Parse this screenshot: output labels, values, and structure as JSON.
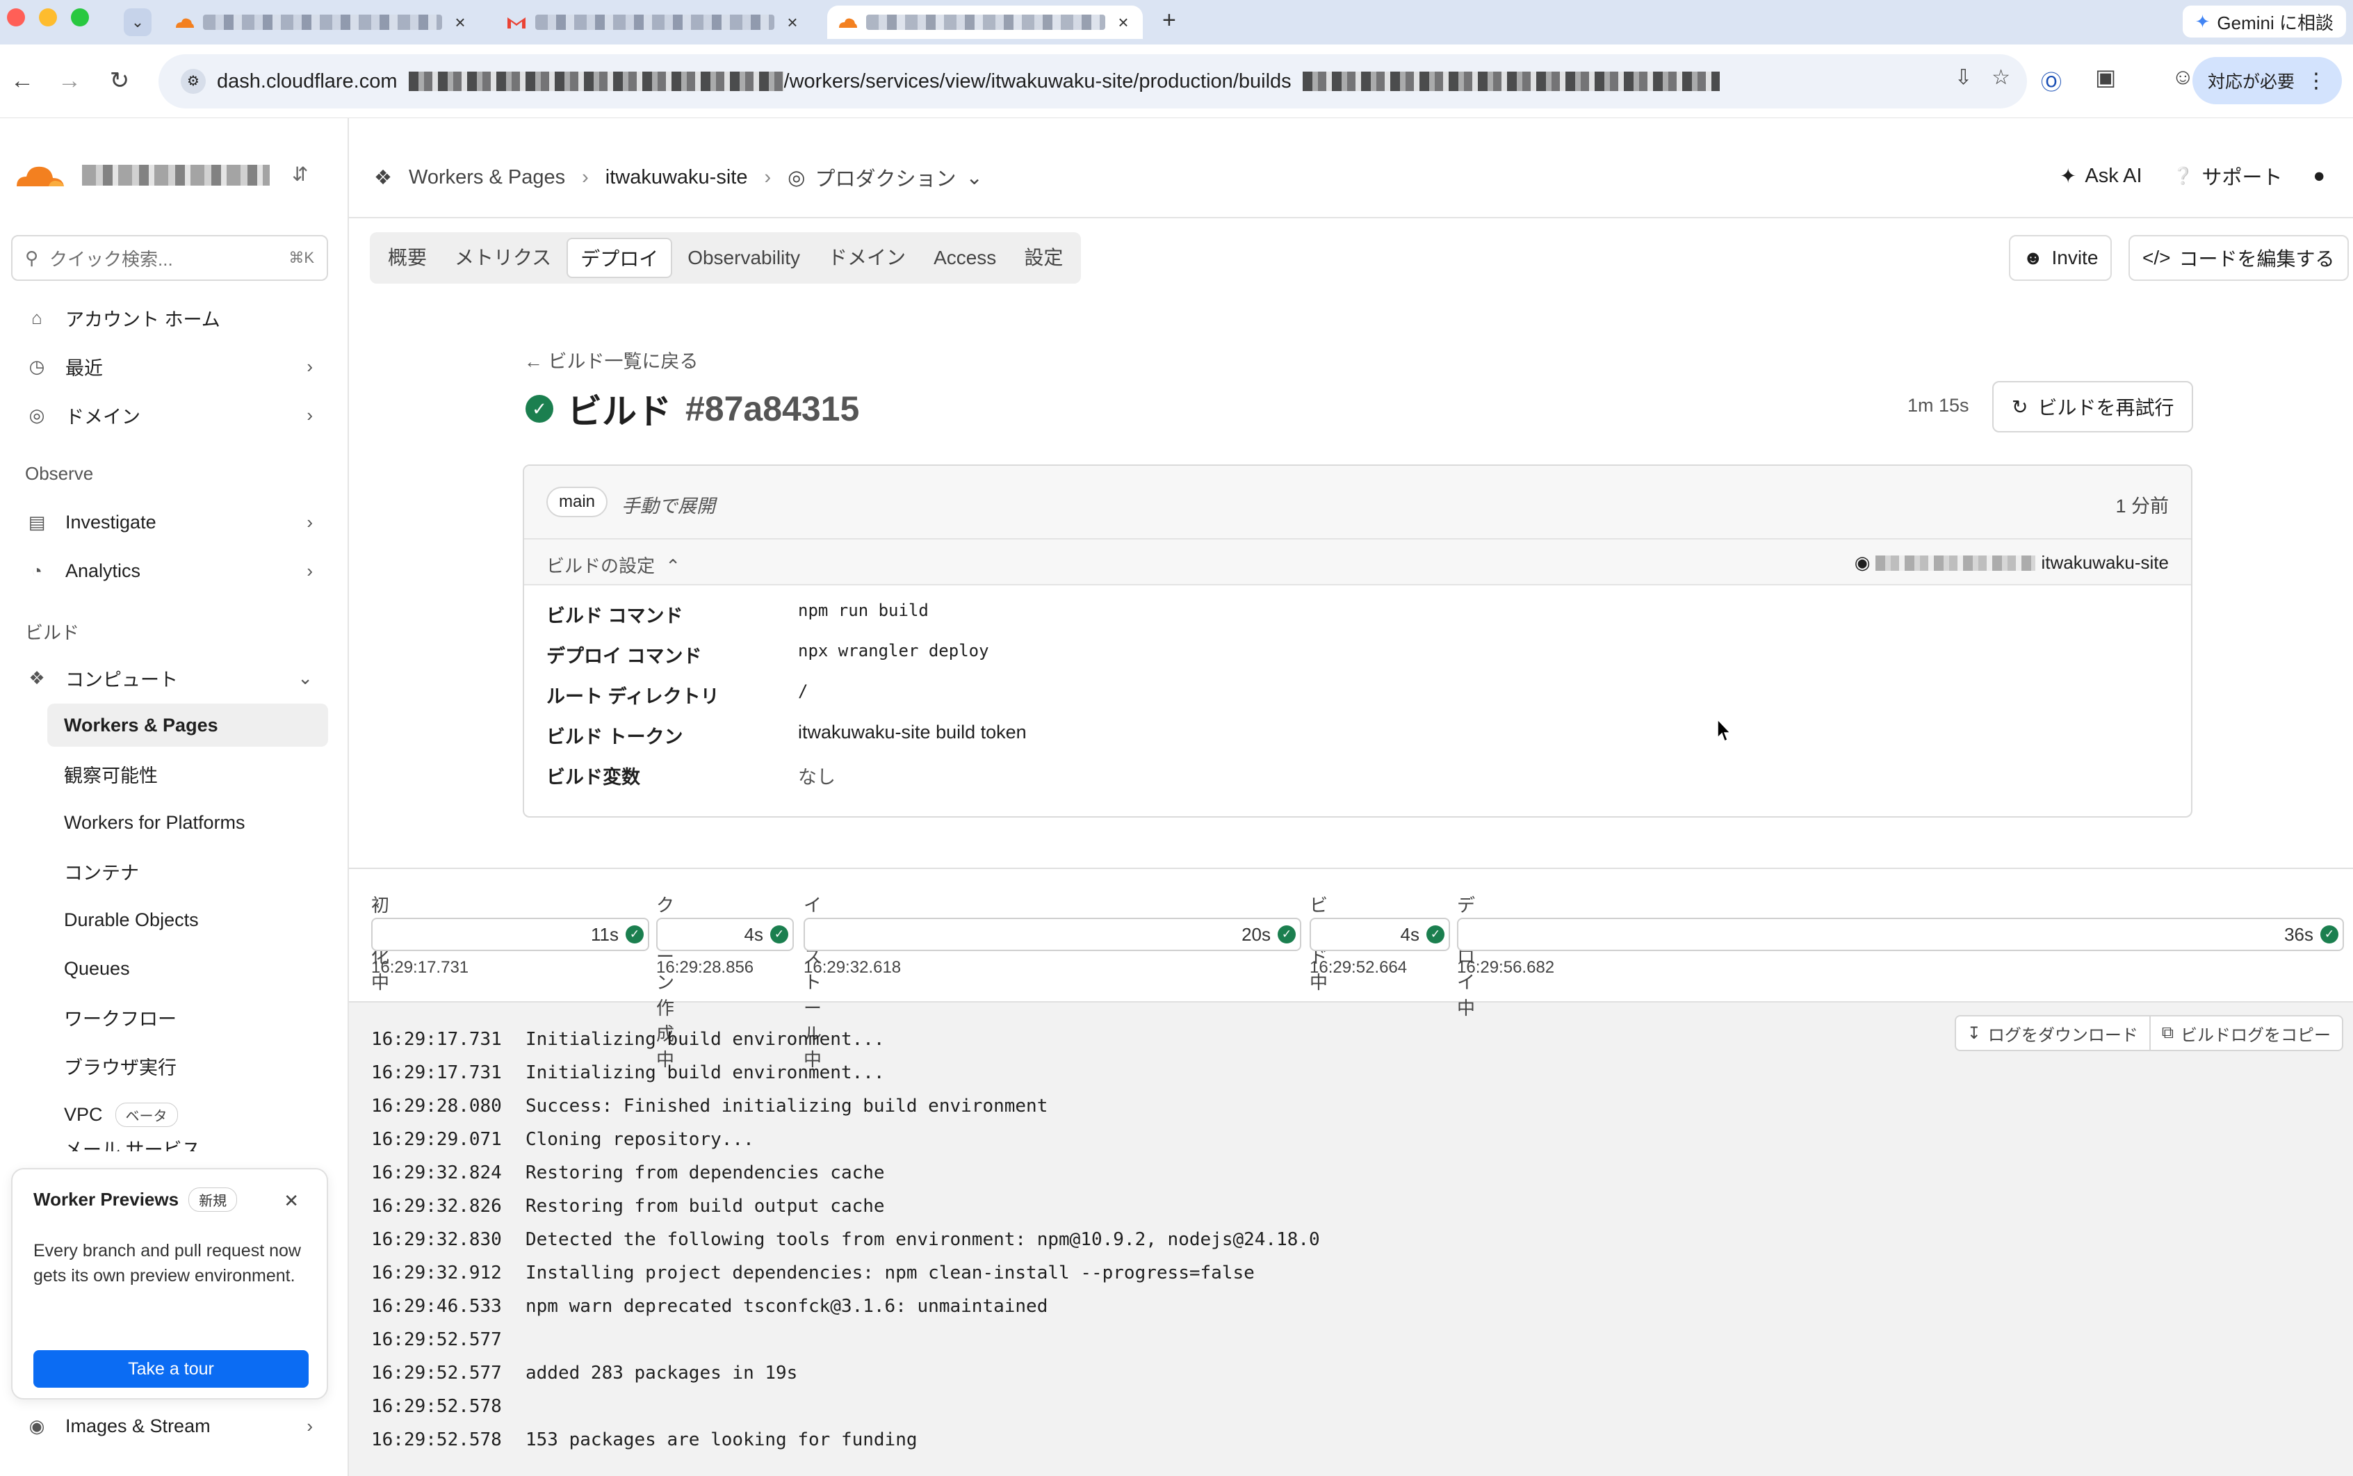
{
  "browser": {
    "tabs": [
      {
        "favicon": "cloudflare-icon",
        "title": ""
      },
      {
        "favicon": "gmail-icon",
        "title": ""
      },
      {
        "favicon": "cloudflare-icon",
        "title": ""
      }
    ],
    "new_tab": "+",
    "gemini_label": "Gemini に相談",
    "url_host": "dash.cloudflare.com",
    "url_path": "/workers/services/view/itwakuwaku-site/production/builds",
    "needs_action_label": "対応が必要"
  },
  "sidebar": {
    "search_placeholder": "クイック検索...",
    "search_shortcut": "⌘K",
    "items": [
      {
        "label": "アカウント ホーム",
        "icon": "home-icon"
      },
      {
        "label": "最近",
        "icon": "clock-icon"
      },
      {
        "label": "ドメイン",
        "icon": "globe-icon"
      }
    ],
    "observe_label": "Observe",
    "observe_items": [
      {
        "label": "Investigate",
        "icon": "investigate-icon"
      },
      {
        "label": "Analytics",
        "icon": "analytics-icon"
      }
    ],
    "build_label": "ビルド",
    "compute_label": "コンピュート",
    "compute_items": [
      {
        "label": "Workers & Pages"
      },
      {
        "label": "観察可能性"
      },
      {
        "label": "Workers for Platforms"
      },
      {
        "label": "コンテナ"
      },
      {
        "label": "Durable Objects"
      },
      {
        "label": "Queues"
      },
      {
        "label": "ワークフロー"
      },
      {
        "label": "ブラウザ実行"
      },
      {
        "label": "VPC"
      }
    ],
    "vpc_badge": "ベータ",
    "clipped_item": "メール サービス",
    "images_label": "Images & Stream",
    "preview_card": {
      "title": "Worker Previews",
      "badge": "新規",
      "description": "Every branch and pull request now gets its own preview environment.",
      "button": "Take a tour"
    }
  },
  "topbar": {
    "breadcrumb": [
      "Workers & Pages",
      "itwakuwaku-site",
      "プロダクション"
    ],
    "ask_ai": "Ask AI",
    "support": "サポート"
  },
  "tabs": [
    "概要",
    "メトリクス",
    "デプロイ",
    "Observability",
    "ドメイン",
    "Access",
    "設定"
  ],
  "actions": {
    "invite": "Invite",
    "edit_code": "コードを編集する"
  },
  "build": {
    "back_label": "ビルド一覧に戻る",
    "title": "ビルド",
    "id": "#87a84315",
    "duration": "1m 15s",
    "retry_label": "ビルドを再試行",
    "branch": "main",
    "trigger": "手動で展開",
    "time_ago": "1 分前",
    "settings_label": "ビルドの設定",
    "repo_suffix": "itwakuwaku-site",
    "settings": [
      {
        "key": "ビルド コマンド",
        "value": "npm run build",
        "mono": true
      },
      {
        "key": "デプロイ コマンド",
        "value": "npx wrangler deploy",
        "mono": true
      },
      {
        "key": "ルート ディレクトリ",
        "value": "/",
        "mono": true
      },
      {
        "key": "ビルド トークン",
        "value": "itwakuwaku-site build token",
        "mono": false
      },
      {
        "key": "ビルド変数",
        "value": "なし",
        "mono": false
      }
    ]
  },
  "stages": [
    {
      "label": "初期化中",
      "duration": "11s",
      "start": "16:29:17.731",
      "status": "success"
    },
    {
      "label": "クローン作成中",
      "duration": "4s",
      "start": "16:29:28.856",
      "status": "success"
    },
    {
      "label": "インストール中",
      "duration": "20s",
      "start": "16:29:32.618",
      "status": "success"
    },
    {
      "label": "ビルド中",
      "duration": "4s",
      "start": "16:29:52.664",
      "status": "success"
    },
    {
      "label": "デプロイ中",
      "duration": "36s",
      "start": "16:29:56.682",
      "status": "success"
    }
  ],
  "log_actions": {
    "download": "ログをダウンロード",
    "copy": "ビルドログをコピー"
  },
  "logs": [
    {
      "ts": "16:29:17.731",
      "msg": "Initializing build environment..."
    },
    {
      "ts": "16:29:17.731",
      "msg": "Initializing build environment..."
    },
    {
      "ts": "16:29:28.080",
      "msg": "Success: Finished initializing build environment"
    },
    {
      "ts": "16:29:29.071",
      "msg": "Cloning repository..."
    },
    {
      "ts": "16:29:32.824",
      "msg": "Restoring from dependencies cache"
    },
    {
      "ts": "16:29:32.826",
      "msg": "Restoring from build output cache"
    },
    {
      "ts": "16:29:32.830",
      "msg": "Detected the following tools from environment: npm@10.9.2, nodejs@24.18.0"
    },
    {
      "ts": "16:29:32.912",
      "msg": "Installing project dependencies: npm clean-install --progress=false"
    },
    {
      "ts": "16:29:46.533",
      "msg": "npm warn deprecated tsconfck@3.1.6: unmaintained"
    },
    {
      "ts": "16:29:52.577",
      "msg": ""
    },
    {
      "ts": "16:29:52.577",
      "msg": "added 283 packages in 19s"
    },
    {
      "ts": "16:29:52.578",
      "msg": ""
    },
    {
      "ts": "16:29:52.578",
      "msg": "153 packages are looking for funding"
    }
  ]
}
